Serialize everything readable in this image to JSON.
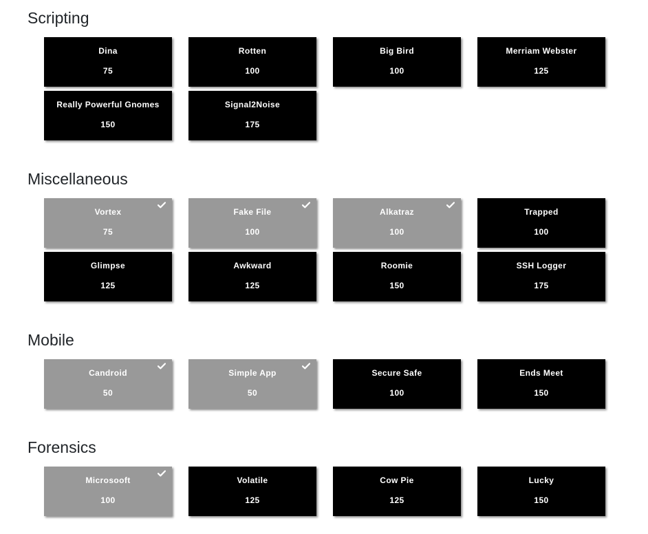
{
  "colors": {
    "unsolved": "#000000",
    "solved": "#999999",
    "text": "#ffffff"
  },
  "categories": [
    {
      "name": "Scripting",
      "challenges": [
        {
          "name": "Dina",
          "points": "75",
          "solved": false
        },
        {
          "name": "Rotten",
          "points": "100",
          "solved": false
        },
        {
          "name": "Big Bird",
          "points": "100",
          "solved": false
        },
        {
          "name": "Merriam Webster",
          "points": "125",
          "solved": false
        },
        {
          "name": "Really Powerful Gnomes",
          "points": "150",
          "solved": false
        },
        {
          "name": "Signal2Noise",
          "points": "175",
          "solved": false
        }
      ]
    },
    {
      "name": "Miscellaneous",
      "challenges": [
        {
          "name": "Vortex",
          "points": "75",
          "solved": true
        },
        {
          "name": "Fake File",
          "points": "100",
          "solved": true
        },
        {
          "name": "Alkatraz",
          "points": "100",
          "solved": true
        },
        {
          "name": "Trapped",
          "points": "100",
          "solved": false
        },
        {
          "name": "Glimpse",
          "points": "125",
          "solved": false
        },
        {
          "name": "Awkward",
          "points": "125",
          "solved": false
        },
        {
          "name": "Roomie",
          "points": "150",
          "solved": false
        },
        {
          "name": "SSH Logger",
          "points": "175",
          "solved": false
        }
      ]
    },
    {
      "name": "Mobile",
      "challenges": [
        {
          "name": "Candroid",
          "points": "50",
          "solved": true
        },
        {
          "name": "Simple App",
          "points": "50",
          "solved": true
        },
        {
          "name": "Secure Safe",
          "points": "100",
          "solved": false
        },
        {
          "name": "Ends Meet",
          "points": "150",
          "solved": false
        }
      ]
    },
    {
      "name": "Forensics",
      "challenges": [
        {
          "name": "Microsooft",
          "points": "100",
          "solved": true
        },
        {
          "name": "Volatile",
          "points": "125",
          "solved": false
        },
        {
          "name": "Cow Pie",
          "points": "125",
          "solved": false
        },
        {
          "name": "Lucky",
          "points": "150",
          "solved": false
        }
      ]
    }
  ]
}
